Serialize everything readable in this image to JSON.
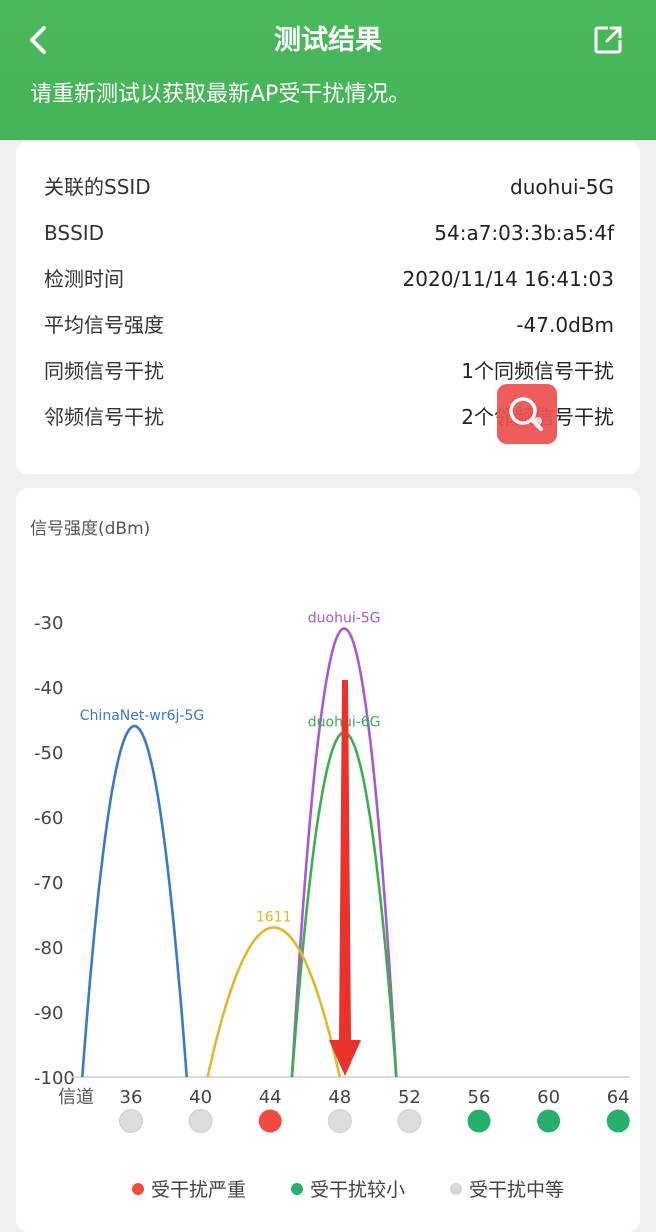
{
  "header": {
    "title": "测试结果",
    "notice": "请重新测试以获取最新AP受干扰情况。"
  },
  "info": {
    "rows": [
      {
        "label": "关联的SSID",
        "value": "duohui-5G"
      },
      {
        "label": "BSSID",
        "value": "54:a7:03:3b:a5:4f"
      },
      {
        "label": "检测时间",
        "value": "2020/11/14 16:41:03"
      },
      {
        "label": "平均信号强度",
        "value": "-47.0dBm"
      },
      {
        "label": "同频信号干扰",
        "value": "1个同频信号干扰"
      },
      {
        "label": "邻频信号干扰",
        "value": "2个邻频信号干扰"
      }
    ]
  },
  "icons": {
    "back": "back-arrow-icon",
    "share": "share-icon",
    "floating": "search-bubble-icon"
  },
  "chart_data": {
    "type": "line",
    "ylabel": "信号强度(dBm)",
    "xlabel": "信道",
    "yticks": [
      "-30",
      "-40",
      "-50",
      "-60",
      "-70",
      "-80",
      "-90",
      "-100"
    ],
    "ylim": [
      -100,
      -30
    ],
    "channels": [
      "36",
      "40",
      "44",
      "48",
      "52",
      "56",
      "60",
      "64"
    ],
    "series": [
      {
        "name": "ChinaNet-wr6j-5G",
        "color": "#3a78c8",
        "center": 36.2,
        "peak": -46,
        "halfwidth": 3.0
      },
      {
        "name": "duohui-5G",
        "color": "#a45ad2",
        "center": 48.25,
        "peak": -31,
        "halfwidth": 3.0
      },
      {
        "name": "duohui-6G",
        "color": "#3cae4f",
        "center": 48.25,
        "peak": -47,
        "halfwidth": 3.0
      },
      {
        "name": "1611",
        "color": "#e4b62a",
        "center": 44.2,
        "peak": -77,
        "halfwidth": 3.8
      }
    ],
    "channel_status": [
      "gray",
      "gray",
      "red",
      "gray",
      "gray",
      "green",
      "green",
      "green"
    ],
    "status_colors": {
      "red": "#ef4c3e",
      "green": "#25b06b",
      "gray": "#dddddd"
    },
    "legend": [
      {
        "label": "受干扰严重",
        "color": "#ef4c3e"
      },
      {
        "label": "受干扰较小",
        "color": "#25b06b"
      },
      {
        "label": "受干扰中等",
        "color": "#d6d6d6"
      }
    ],
    "arrow_color": "#e8322b"
  }
}
